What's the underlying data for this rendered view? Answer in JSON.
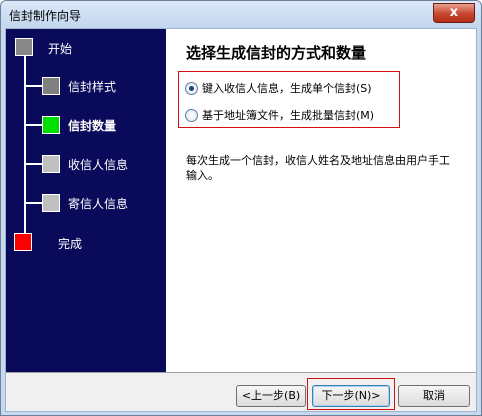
{
  "window": {
    "title": "信封制作向导",
    "close_label": "x"
  },
  "steps": [
    {
      "label": "开始",
      "color": "#888888",
      "current": false
    },
    {
      "label": "信封样式",
      "color": "#808080",
      "current": false
    },
    {
      "label": "信封数量",
      "color": "#00e000",
      "current": true
    },
    {
      "label": "收信人信息",
      "color": "#c0c0c0",
      "current": false
    },
    {
      "label": "寄信人信息",
      "color": "#c0c0c0",
      "current": false
    },
    {
      "label": "完成",
      "color": "#ff0000",
      "current": false
    }
  ],
  "main": {
    "heading": "选择生成信封的方式和数量",
    "options": [
      {
        "label": "键入收信人信息，生成单个信封(S)",
        "checked": true
      },
      {
        "label": "基于地址簿文件，生成批量信封(M)",
        "checked": false
      }
    ],
    "description": "每次生成一个信封，收信人姓名及地址信息由用户手工输入。"
  },
  "footer": {
    "back_label": "<上一步(B)",
    "next_label": "下一步(N)>",
    "cancel_label": "取消"
  },
  "colors": {
    "panel_bg": "#0a0a5a",
    "highlight_border": "#d01010"
  }
}
